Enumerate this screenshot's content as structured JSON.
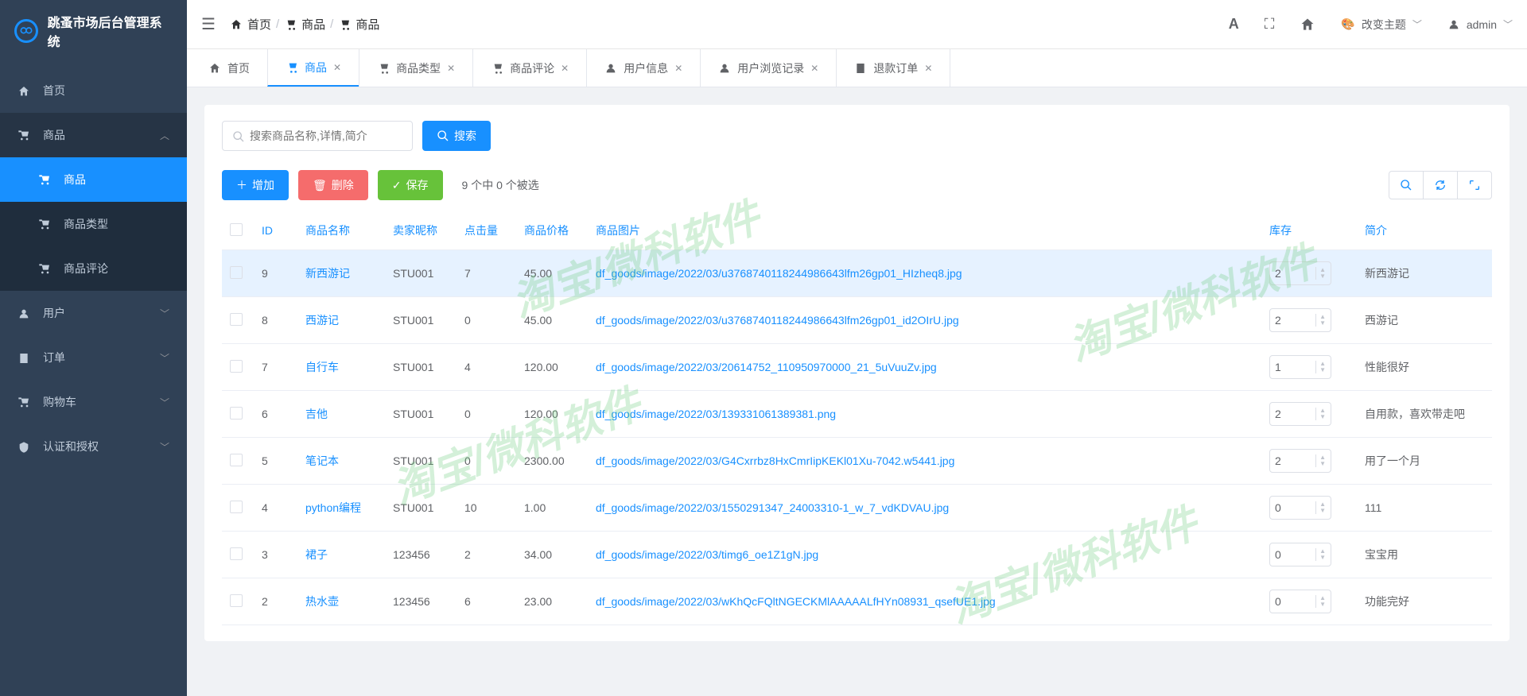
{
  "app": {
    "title": "跳蚤市场后台管理系统"
  },
  "sidebar": {
    "items": [
      {
        "label": "首页"
      },
      {
        "label": "商品",
        "expanded": true,
        "children": [
          {
            "label": "商品",
            "active": true
          },
          {
            "label": "商品类型"
          },
          {
            "label": "商品评论"
          }
        ]
      },
      {
        "label": "用户"
      },
      {
        "label": "订单"
      },
      {
        "label": "购物车"
      },
      {
        "label": "认证和授权"
      }
    ]
  },
  "header": {
    "breadcrumb": [
      {
        "label": "首页"
      },
      {
        "label": "商品"
      },
      {
        "label": "商品"
      }
    ],
    "theme_label": "改变主题",
    "user": "admin"
  },
  "tabs": [
    {
      "label": "首页",
      "closable": false,
      "active": false
    },
    {
      "label": "商品",
      "closable": true,
      "active": true
    },
    {
      "label": "商品类型",
      "closable": true
    },
    {
      "label": "商品评论",
      "closable": true
    },
    {
      "label": "用户信息",
      "closable": true
    },
    {
      "label": "用户浏览记录",
      "closable": true
    },
    {
      "label": "退款订单",
      "closable": true
    }
  ],
  "search": {
    "placeholder": "搜索商品名称,详情,简介",
    "button": "搜索"
  },
  "toolbar": {
    "add": "增加",
    "delete": "删除",
    "save": "保存",
    "selection_text": "9 个中 0 个被选"
  },
  "table": {
    "headers": [
      "",
      "ID",
      "商品名称",
      "卖家昵称",
      "点击量",
      "商品价格",
      "商品图片",
      "库存",
      "简介"
    ],
    "rows": [
      {
        "id": "9",
        "name": "新西游记",
        "seller": "STU001",
        "clicks": "7",
        "price": "45.00",
        "img": "df_goods/image/2022/03/u3768740118244986643lfm26gp01_HIzheq8.jpg",
        "stock": "2",
        "intro": "新西游记",
        "highlighted": true
      },
      {
        "id": "8",
        "name": "西游记",
        "seller": "STU001",
        "clicks": "0",
        "price": "45.00",
        "img": "df_goods/image/2022/03/u3768740118244986643lfm26gp01_id2OIrU.jpg",
        "stock": "2",
        "intro": "西游记"
      },
      {
        "id": "7",
        "name": "自行车",
        "seller": "STU001",
        "clicks": "4",
        "price": "120.00",
        "img": "df_goods/image/2022/03/20614752_110950970000_21_5uVuuZv.jpg",
        "stock": "1",
        "intro": "性能很好"
      },
      {
        "id": "6",
        "name": "吉他",
        "seller": "STU001",
        "clicks": "0",
        "price": "120.00",
        "img": "df_goods/image/2022/03/139331061389381.png",
        "stock": "2",
        "intro": "自用款，喜欢带走吧"
      },
      {
        "id": "5",
        "name": "笔记本",
        "seller": "STU001",
        "clicks": "0",
        "price": "2300.00",
        "img": "df_goods/image/2022/03/G4Cxrrbz8HxCmrIipKEKl01Xu-7042.w5441.jpg",
        "stock": "2",
        "intro": "用了一个月"
      },
      {
        "id": "4",
        "name": "python编程",
        "seller": "STU001",
        "clicks": "10",
        "price": "1.00",
        "img": "df_goods/image/2022/03/1550291347_24003310-1_w_7_vdKDVAU.jpg",
        "stock": "0",
        "intro": "111"
      },
      {
        "id": "3",
        "name": "裙子",
        "seller": "123456",
        "clicks": "2",
        "price": "34.00",
        "img": "df_goods/image/2022/03/timg6_oe1Z1gN.jpg",
        "stock": "0",
        "intro": "宝宝用"
      },
      {
        "id": "2",
        "name": "热水壶",
        "seller": "123456",
        "clicks": "6",
        "price": "23.00",
        "img": "df_goods/image/2022/03/wKhQcFQltNGECKMlAAAAALfHYn08931_qsefUE1.jpg",
        "stock": "0",
        "intro": "功能完好"
      }
    ]
  },
  "watermark": "淘宝/微科软件"
}
